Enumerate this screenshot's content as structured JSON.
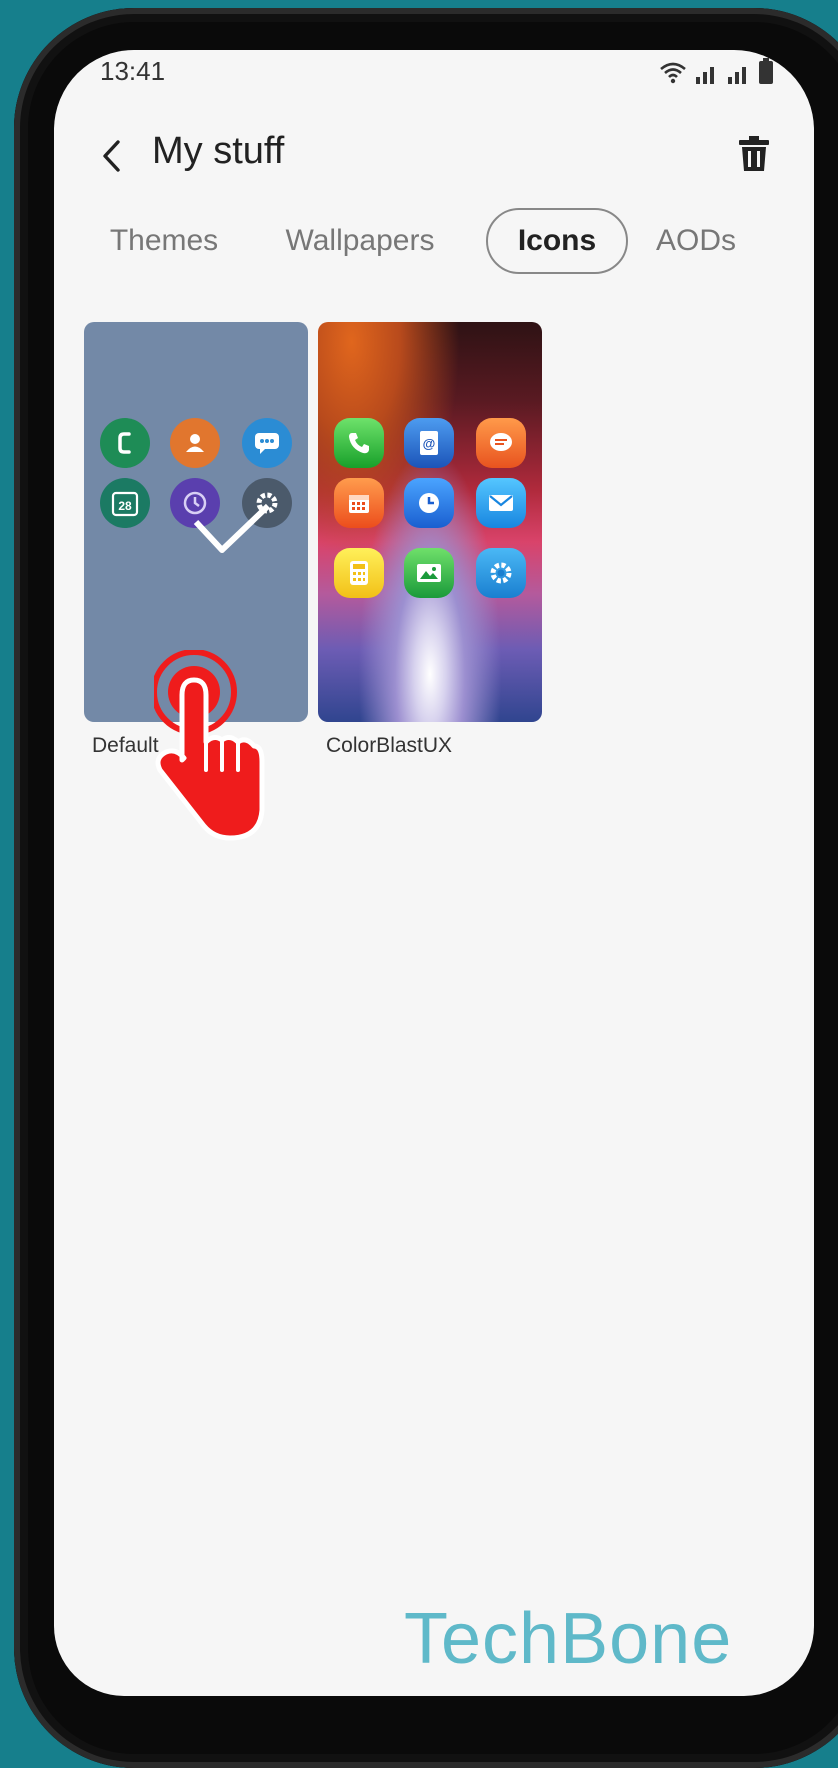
{
  "status_bar": {
    "time": "13:41"
  },
  "app_bar": {
    "title": "My stuff"
  },
  "tabs": [
    {
      "label": "Themes",
      "active": false
    },
    {
      "label": "Wallpapers",
      "active": false
    },
    {
      "label": "Icons",
      "active": true
    },
    {
      "label": "AODs",
      "active": false
    }
  ],
  "icon_packs": [
    {
      "name": "Default",
      "selected": true
    },
    {
      "name": "ColorBlastUX",
      "selected": false
    }
  ],
  "default_icons": {
    "calendar_date": "28"
  },
  "watermark": "TechBone",
  "colors": {
    "accent": "#222222",
    "default_pack_bg": "#7389a7",
    "tap_indicator": "#ef1c1c",
    "watermark": "#5fb9c9",
    "frame_bg": "#167f8c"
  }
}
